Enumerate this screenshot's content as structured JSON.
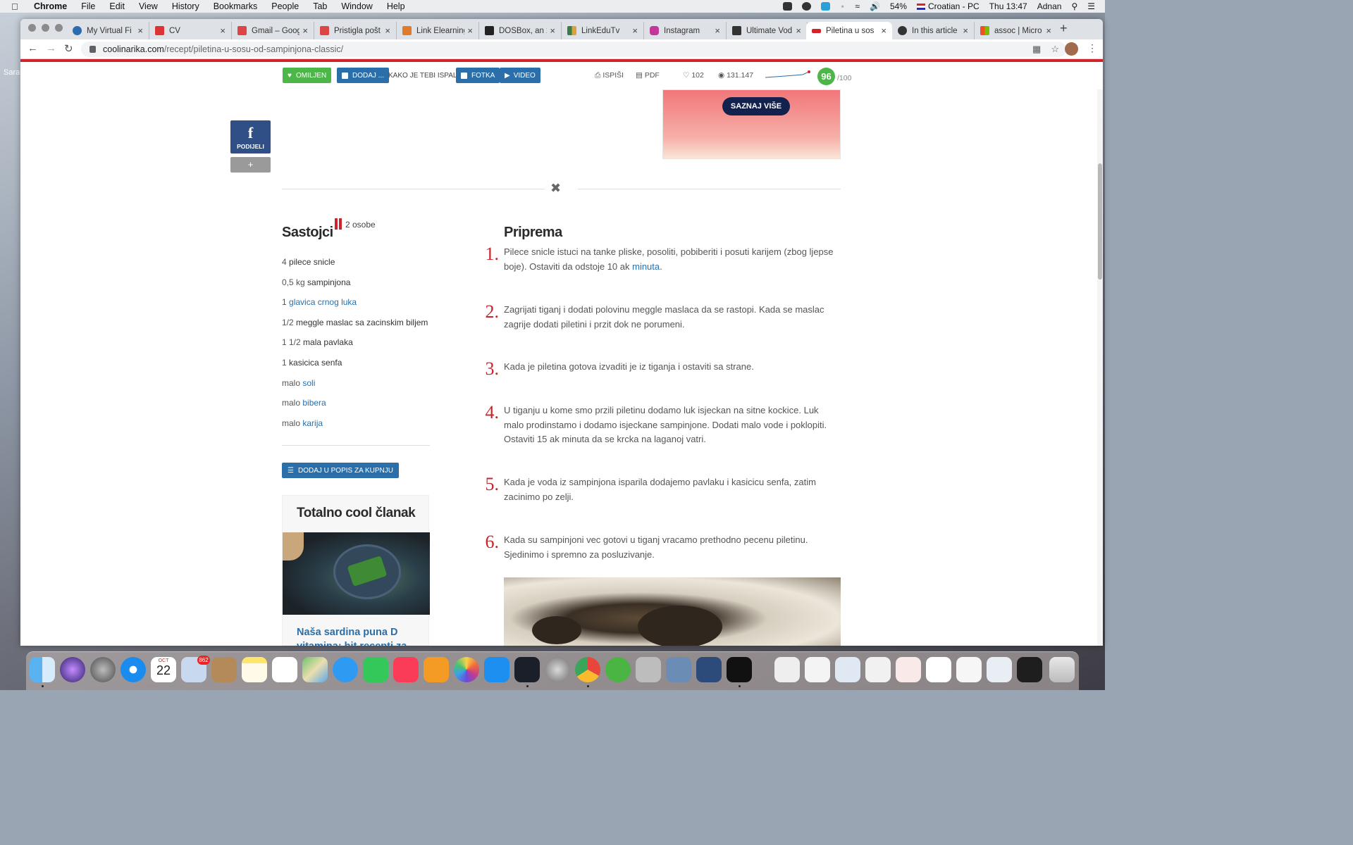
{
  "menubar": {
    "app": "Chrome",
    "items": [
      "File",
      "Edit",
      "View",
      "History",
      "Bookmarks",
      "People",
      "Tab",
      "Window",
      "Help"
    ],
    "battery": "54%",
    "keyboard": "Croatian - PC",
    "clock": "Thu 13:47",
    "user": "Adnan"
  },
  "tabs": [
    {
      "title": "My Virtual Fi",
      "color": "#2b6cb0"
    },
    {
      "title": "CV",
      "color": "#d33"
    },
    {
      "title": "Gmail – Googl",
      "color": "#d44"
    },
    {
      "title": "Pristigla pošt",
      "color": "#d44"
    },
    {
      "title": "Link Elearning",
      "color": "#e07b2a"
    },
    {
      "title": "DOSBox, an x",
      "color": "#222"
    },
    {
      "title": "LinkEduTv",
      "color": "#3a7d44"
    },
    {
      "title": "Instagram",
      "color": "#c2379b"
    },
    {
      "title": "Ultimate Vodi",
      "color": "#333"
    },
    {
      "title": "Piletina u sos",
      "color": "#d2232a"
    },
    {
      "title": "In this article",
      "color": "#333"
    },
    {
      "title": "assoc | Micro",
      "color": "#f25022"
    }
  ],
  "url": {
    "host": "coolinarika.com",
    "path": "/recept/piletina-u-sosu-od-sampinjona-classic/"
  },
  "toolbar": {
    "fav_label": "OMILJEN",
    "add_label": "DODAJ ...",
    "prompt": "KAKO JE TEBI ISPALO?",
    "photo_label": "FOTKA",
    "video_label": "VIDEO",
    "print_label": "ISPIŠI",
    "pdf_label": "PDF",
    "likes": "102",
    "views": "131.147",
    "score": "96",
    "score_max": "/100"
  },
  "ad": {
    "button": "SAZNAJ VIŠE"
  },
  "share": {
    "fb_letter": "f",
    "fb_label": "PODIJELI",
    "plus": "+"
  },
  "ingredients": {
    "title": "Sastojci",
    "servings": "2 osobe",
    "items": [
      {
        "qty": "4",
        "name": "pilece snicle",
        "link": false
      },
      {
        "qty": "0,5 kg",
        "name": "sampinjona",
        "link": false
      },
      {
        "qty": "1",
        "name": "glavica crnog luka",
        "link": true
      },
      {
        "qty": "1/2",
        "name": "meggle maslac sa zacinskim biljem",
        "link": false
      },
      {
        "qty": "1 1/2",
        "name": "mala pavlaka",
        "link": false
      },
      {
        "qty": "1",
        "name": "kasicica senfa",
        "link": false
      },
      {
        "qty": "malo",
        "name": "soli",
        "link": true
      },
      {
        "qty": "malo",
        "name": "bibera",
        "link": true
      },
      {
        "qty": "malo",
        "name": "karija",
        "link": true
      }
    ],
    "shop_button": "DODAJ U POPIS ZA KUPNJU"
  },
  "article": {
    "title": "Totalno cool članak",
    "link": "Naša sardina puna D vitamina: hit recepti za"
  },
  "preparation": {
    "title": "Priprema",
    "steps": [
      {
        "n": "1.",
        "pre": "Pilece snicle istuci na tanke pliske, posoliti, pobiberiti i posuti karijem (zbog ljepse boje). Ostaviti da odstoje 10 ak ",
        "link": "minuta",
        "post": "."
      },
      {
        "n": "2.",
        "pre": "Zagrijati tiganj i dodati polovinu meggle maslaca da se rastopi. Kada se maslac zagrije dodati piletini i przit dok ne porumeni.",
        "link": "",
        "post": ""
      },
      {
        "n": "3.",
        "pre": "Kada je piletina gotova izvaditi je iz tiganja i ostaviti sa strane.",
        "link": "",
        "post": ""
      },
      {
        "n": "4.",
        "pre": "U tiganju u kome smo przili piletinu dodamo luk isjeckan na sitne kockice. Luk malo prodinstamo i dodamo isjeckane sampinjone. Dodati malo vode i poklopiti. Ostaviti 15 ak minuta da se krcka na laganoj vatri.",
        "link": "",
        "post": ""
      },
      {
        "n": "5.",
        "pre": "Kada je voda iz sampinjona isparila dodajemo pavlaku i kasicicu senfa, zatim zacinimo po zelji.",
        "link": "",
        "post": ""
      },
      {
        "n": "6.",
        "pre": "Kada su sampinjoni vec gotovi u tiganj vracamo prethodno pecenu piletinu. Sjedinimo i spremno za posluzivanje.",
        "link": "",
        "post": ""
      }
    ]
  },
  "dock": {
    "calendar_month": "OCT",
    "calendar_day": "22",
    "mail_badge": "862"
  },
  "desktop": {
    "side_label": "Sara"
  }
}
